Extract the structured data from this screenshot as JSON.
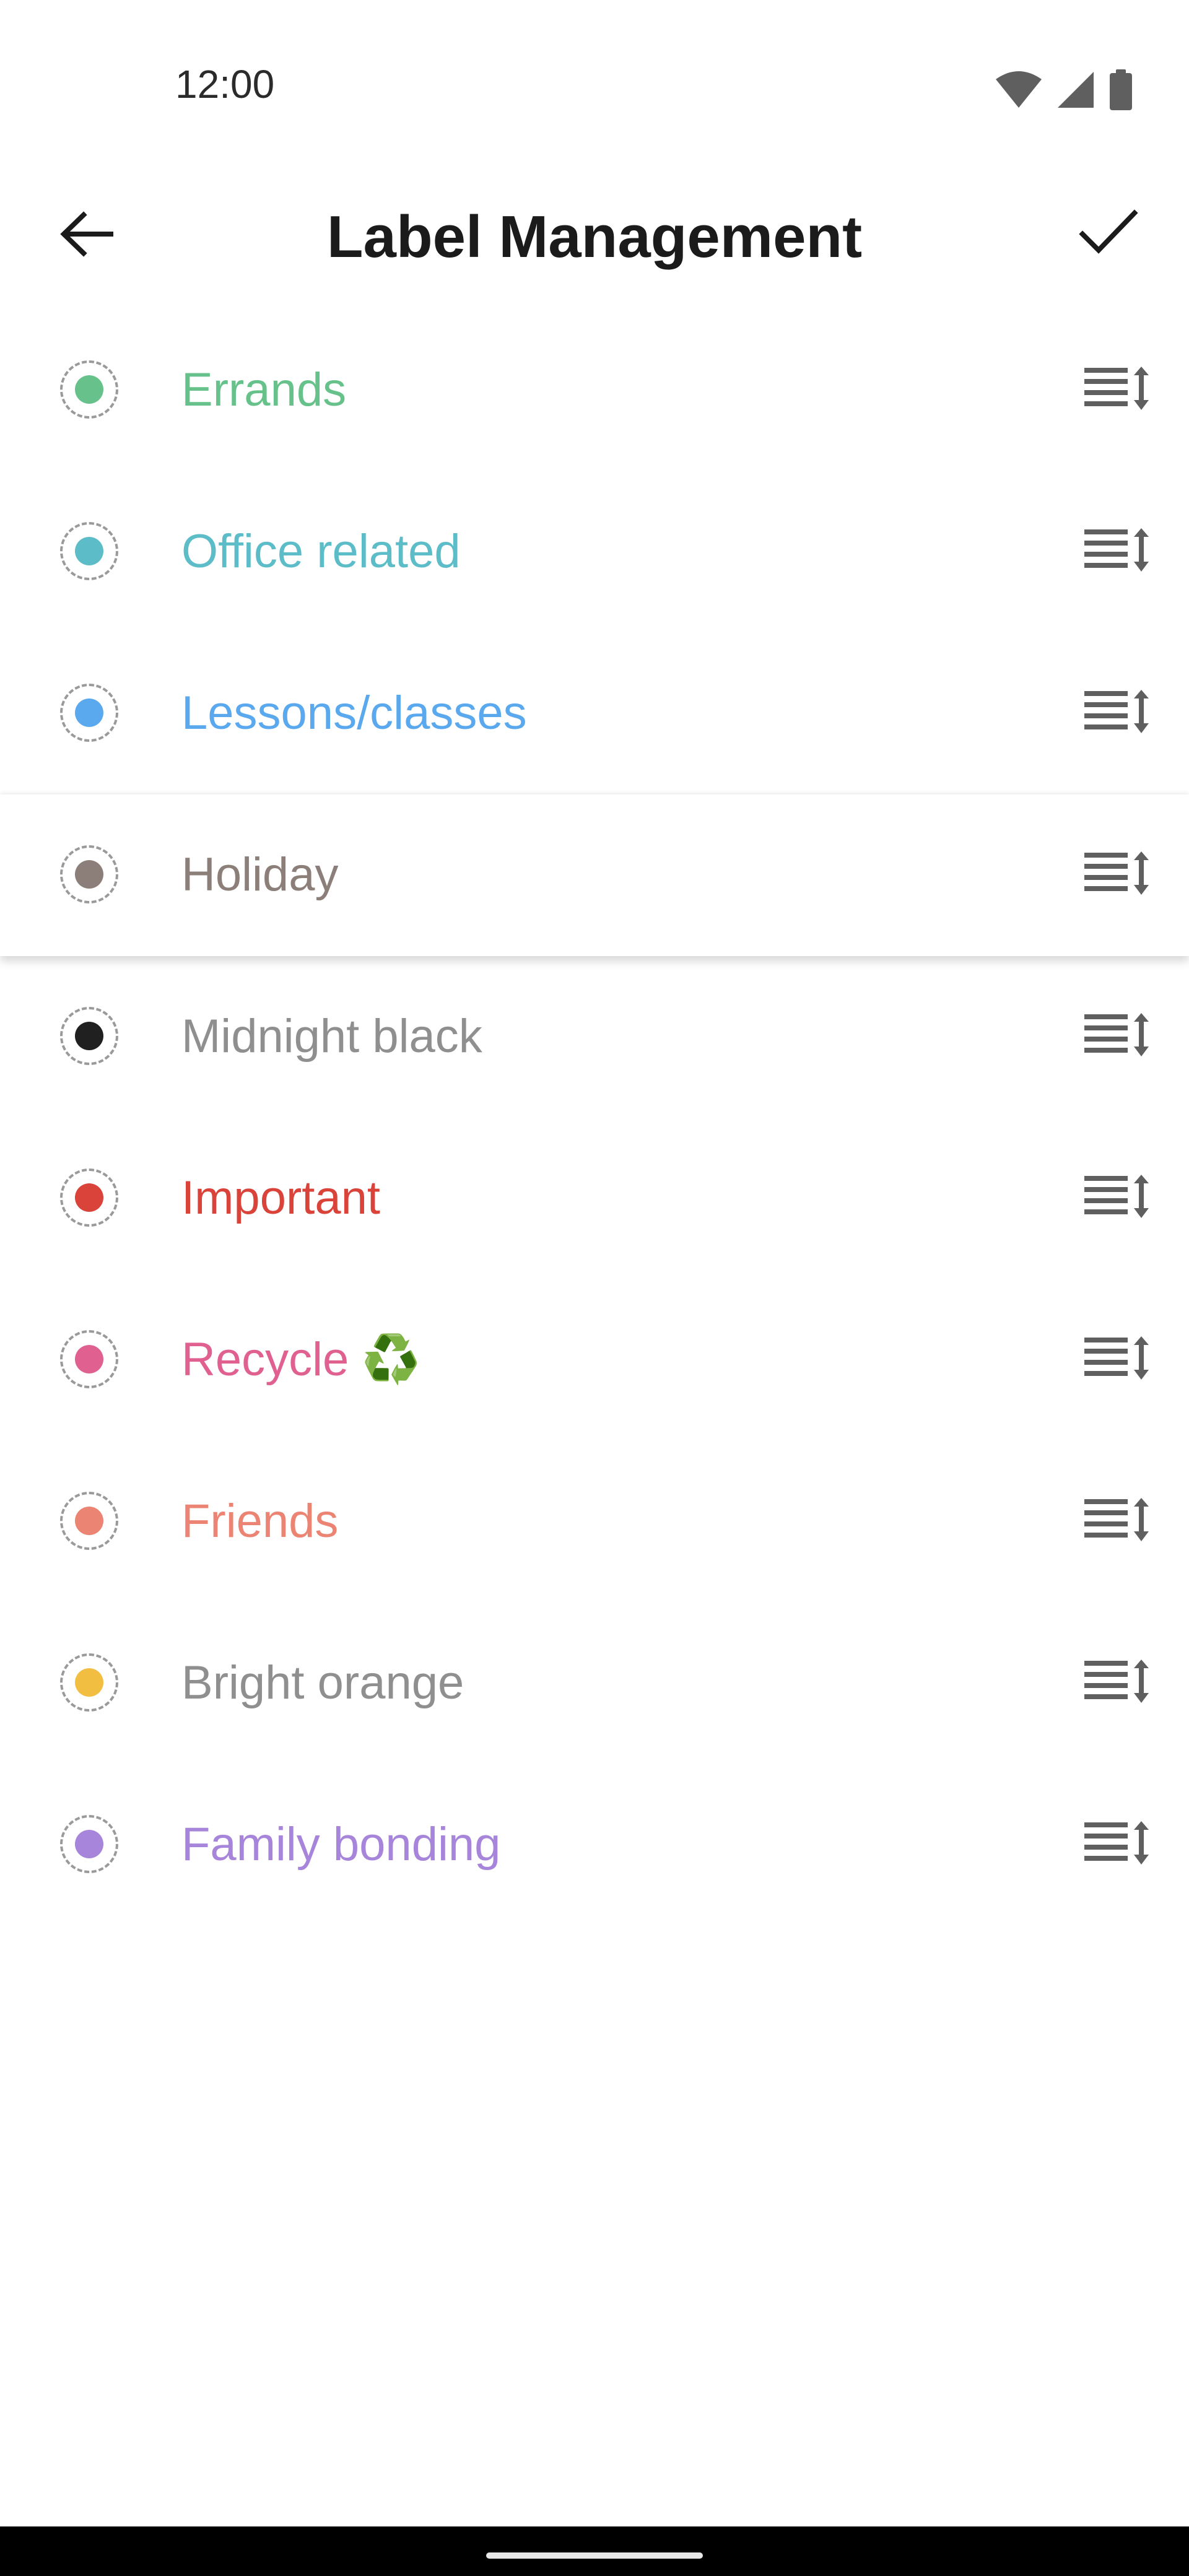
{
  "status_bar": {
    "time": "12:00",
    "icons": [
      "wifi-icon",
      "cell-signal-icon",
      "battery-icon"
    ]
  },
  "app_bar": {
    "title": "Label Management",
    "back_icon": "arrow-back-icon",
    "done_icon": "checkmark-icon"
  },
  "labels": [
    {
      "name": "Errands",
      "color": "#66C28A",
      "text_color": "#66C28A"
    },
    {
      "name": "Office related",
      "color": "#5CBCC8",
      "text_color": "#5CBCC8"
    },
    {
      "name": "Lessons/classes",
      "color": "#5AA9EE",
      "text_color": "#5AA9EE"
    },
    {
      "name": "Holiday",
      "color": "#8C7E78",
      "text_color": "#8C7E78",
      "dragging": true
    },
    {
      "name": "Midnight black",
      "color": "#202020",
      "text_color": "#8F8F8F"
    },
    {
      "name": "Important",
      "color": "#D9433A",
      "text_color": "#D9433A"
    },
    {
      "name": "Recycle ♻️",
      "color": "#E06190",
      "text_color": "#E06190"
    },
    {
      "name": "Friends",
      "color": "#EC8474",
      "text_color": "#EC8474"
    },
    {
      "name": "Bright orange",
      "color": "#F2BE42",
      "text_color": "#8F8F8F"
    },
    {
      "name": "Family bonding",
      "color": "#A685DA",
      "text_color": "#A685DA"
    }
  ],
  "reorder_icon": "drag-reorder-icon",
  "colors": {
    "title": "#1B1B1B",
    "icon": "#5F5F5F",
    "nav_bar": "#000000"
  }
}
